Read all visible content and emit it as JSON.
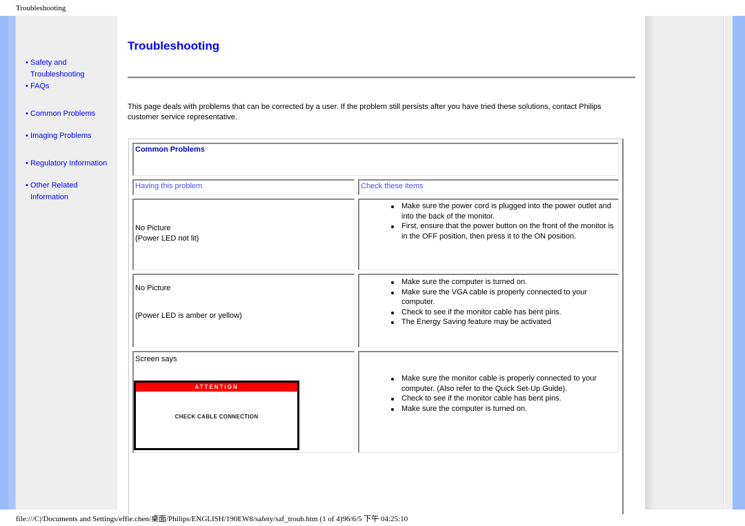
{
  "header": {
    "doc_title": "Troubleshooting"
  },
  "sidebar": {
    "items": [
      {
        "lines": [
          "Safety and",
          "Troubleshooting"
        ]
      },
      {
        "lines": [
          "FAQs"
        ]
      },
      {
        "lines": [
          "Common Problems"
        ]
      },
      {
        "lines": [
          "Imaging Problems"
        ]
      },
      {
        "lines": [
          "Regulatory Information"
        ]
      },
      {
        "lines": [
          "Other Related",
          "Information"
        ]
      }
    ],
    "bullet": "•"
  },
  "main": {
    "title": "Troubleshooting",
    "intro": "This page deals with problems that can be corrected by a user. If the problem still persists after you have tried these solutions, contact Philips customer service representative.",
    "section_heading": "Common Problems",
    "columns": {
      "problem": "Having this problem",
      "check": "Check these items"
    },
    "rows": [
      {
        "problem_lines": [
          "No Picture",
          "(Power LED not lit)"
        ],
        "checks": [
          "Make sure the power cord is plugged into the power outlet and into the back of the monitor.",
          "First, ensure that the power button on the front of the monitor is in the OFF position, then press it to the ON position."
        ]
      },
      {
        "problem_lines": [
          "No Picture",
          "(Power LED is amber or yellow)"
        ],
        "checks": [
          "Make sure the computer is turned on.",
          "Make sure the VGA cable is properly connected to your computer.",
          "Check to see if the monitor cable has bent pins.",
          "The Energy Saving feature may be activated"
        ]
      },
      {
        "problem_lines": [
          "Screen says"
        ],
        "screen_message": {
          "title": "ATTENTION",
          "message": "CHECK CABLE CONNECTION"
        },
        "checks": [
          "Make sure the monitor cable is properly connected to your computer. (Also refer to the Quick Set-Up Guide).",
          "Check to see if the monitor cable has bent pins.",
          "Make sure the computer is turned on."
        ]
      }
    ]
  },
  "footer": {
    "path": "file:///C|/Documents and Settings/effie.chen/桌面/Philips/ENGLISH/190EW8/safety/saf_troub.htm (1 of 4)96/6/5 下午 04:25:10"
  },
  "colors": {
    "link": "#0000ff",
    "column_head": "#4a4aff",
    "accent_bar": "#99bbf7",
    "attention": "#ff0000"
  }
}
